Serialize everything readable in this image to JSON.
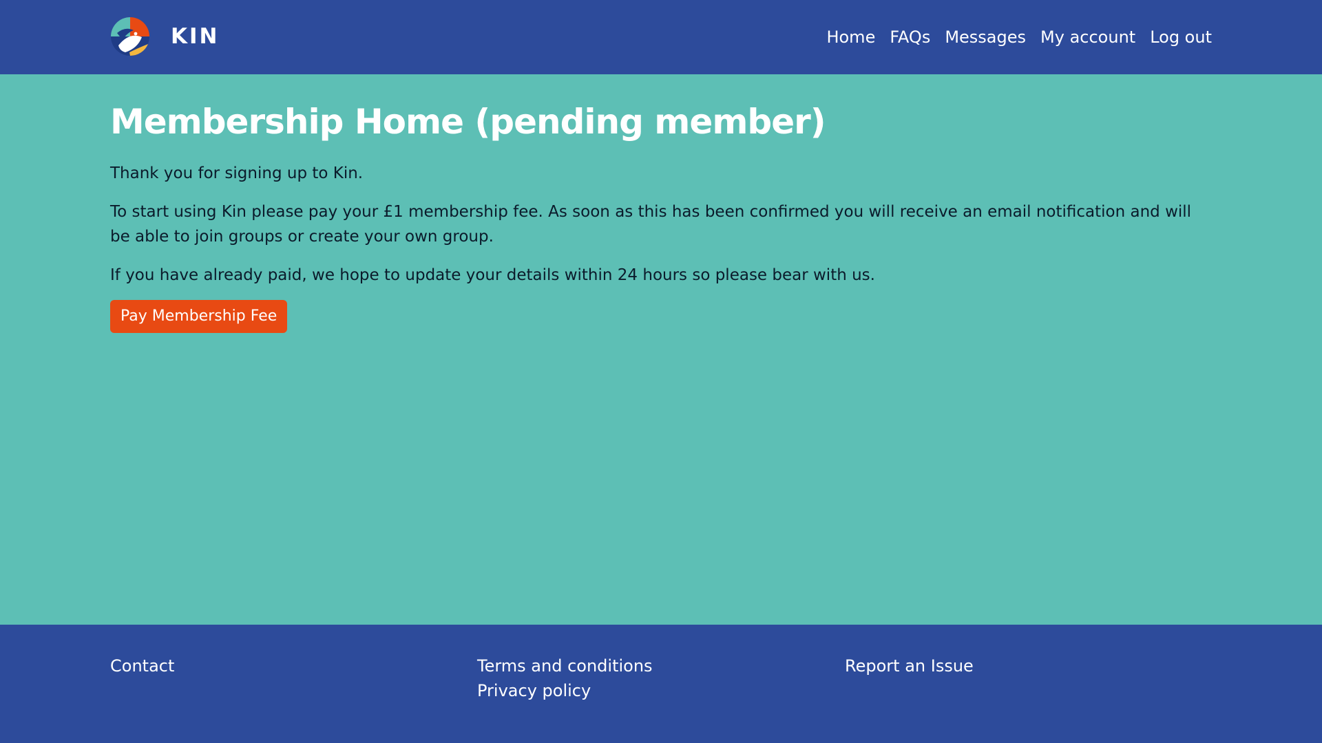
{
  "header": {
    "brand_name": "KIN",
    "logo_icon": "kin-bird-logo-icon",
    "nav": {
      "home": "Home",
      "faqs": "FAQs",
      "messages": "Messages",
      "my_account": "My account",
      "log_out": "Log out"
    }
  },
  "main": {
    "title": "Membership Home (pending member)",
    "paragraph_1": "Thank you for signing up to Kin.",
    "paragraph_2": "To start using Kin please pay your £1 membership fee. As soon as this has been confirmed you will receive an email notification and will be able to join groups or create your own group.",
    "paragraph_3": "If you have already paid, we hope to update your details within 24 hours so please bear with us.",
    "pay_button_label": "Pay Membership Fee"
  },
  "footer": {
    "contact": "Contact",
    "terms": "Terms and conditions",
    "privacy": "Privacy policy",
    "report": "Report an Issue"
  },
  "colors": {
    "header_bg": "#2d4b9b",
    "page_bg": "#5dbfb5",
    "button_bg": "#e84a13",
    "text_dark": "#0b1b2b"
  }
}
